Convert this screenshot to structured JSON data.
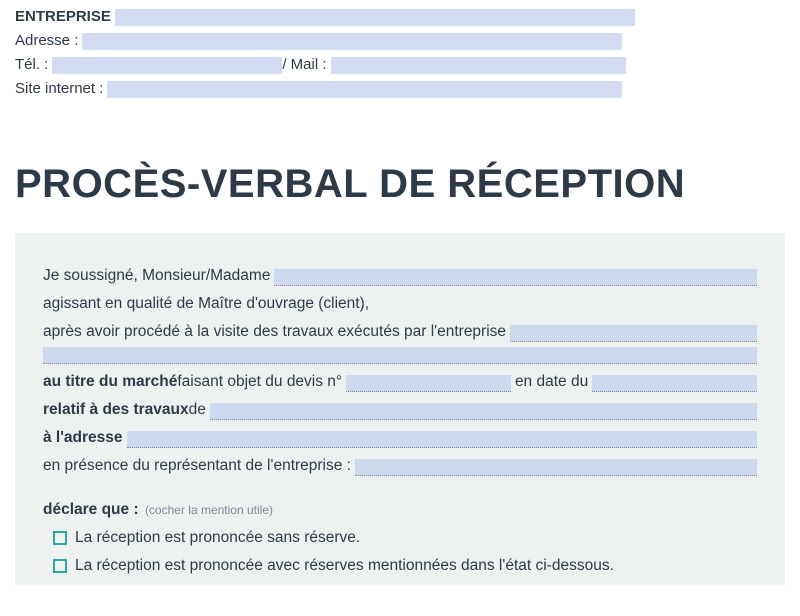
{
  "header": {
    "entreprise_label": "ENTREPRISE",
    "adresse_label": "Adresse :",
    "tel_label": "Tél. :",
    "mail_sep": " / Mail :",
    "site_label": "Site internet :"
  },
  "title": "PROCÈS-VERBAL DE RÉCEPTION",
  "body": {
    "line1_a": "Je soussigné, Monsieur/Madame",
    "line2": "agissant en qualité de Maître d'ouvrage (client),",
    "line3_a": "après avoir procédé à la visite des travaux exécutés par l'entreprise",
    "line5_a": "au titre du marché",
    "line5_b": " faisant objet du devis n°",
    "line5_c": " en date du",
    "line6_a": "relatif à des travaux",
    "line6_b": " de",
    "line7_a": "à l'adresse",
    "line8": "en présence du représentant de l'entreprise :"
  },
  "declare": {
    "label": "déclare que :",
    "hint": "(cocher la mention utile)",
    "opt1": "La réception est prononcée sans réserve.",
    "opt2": "La réception est prononcée avec réserves mentionnées dans l'état ci-dessous."
  }
}
